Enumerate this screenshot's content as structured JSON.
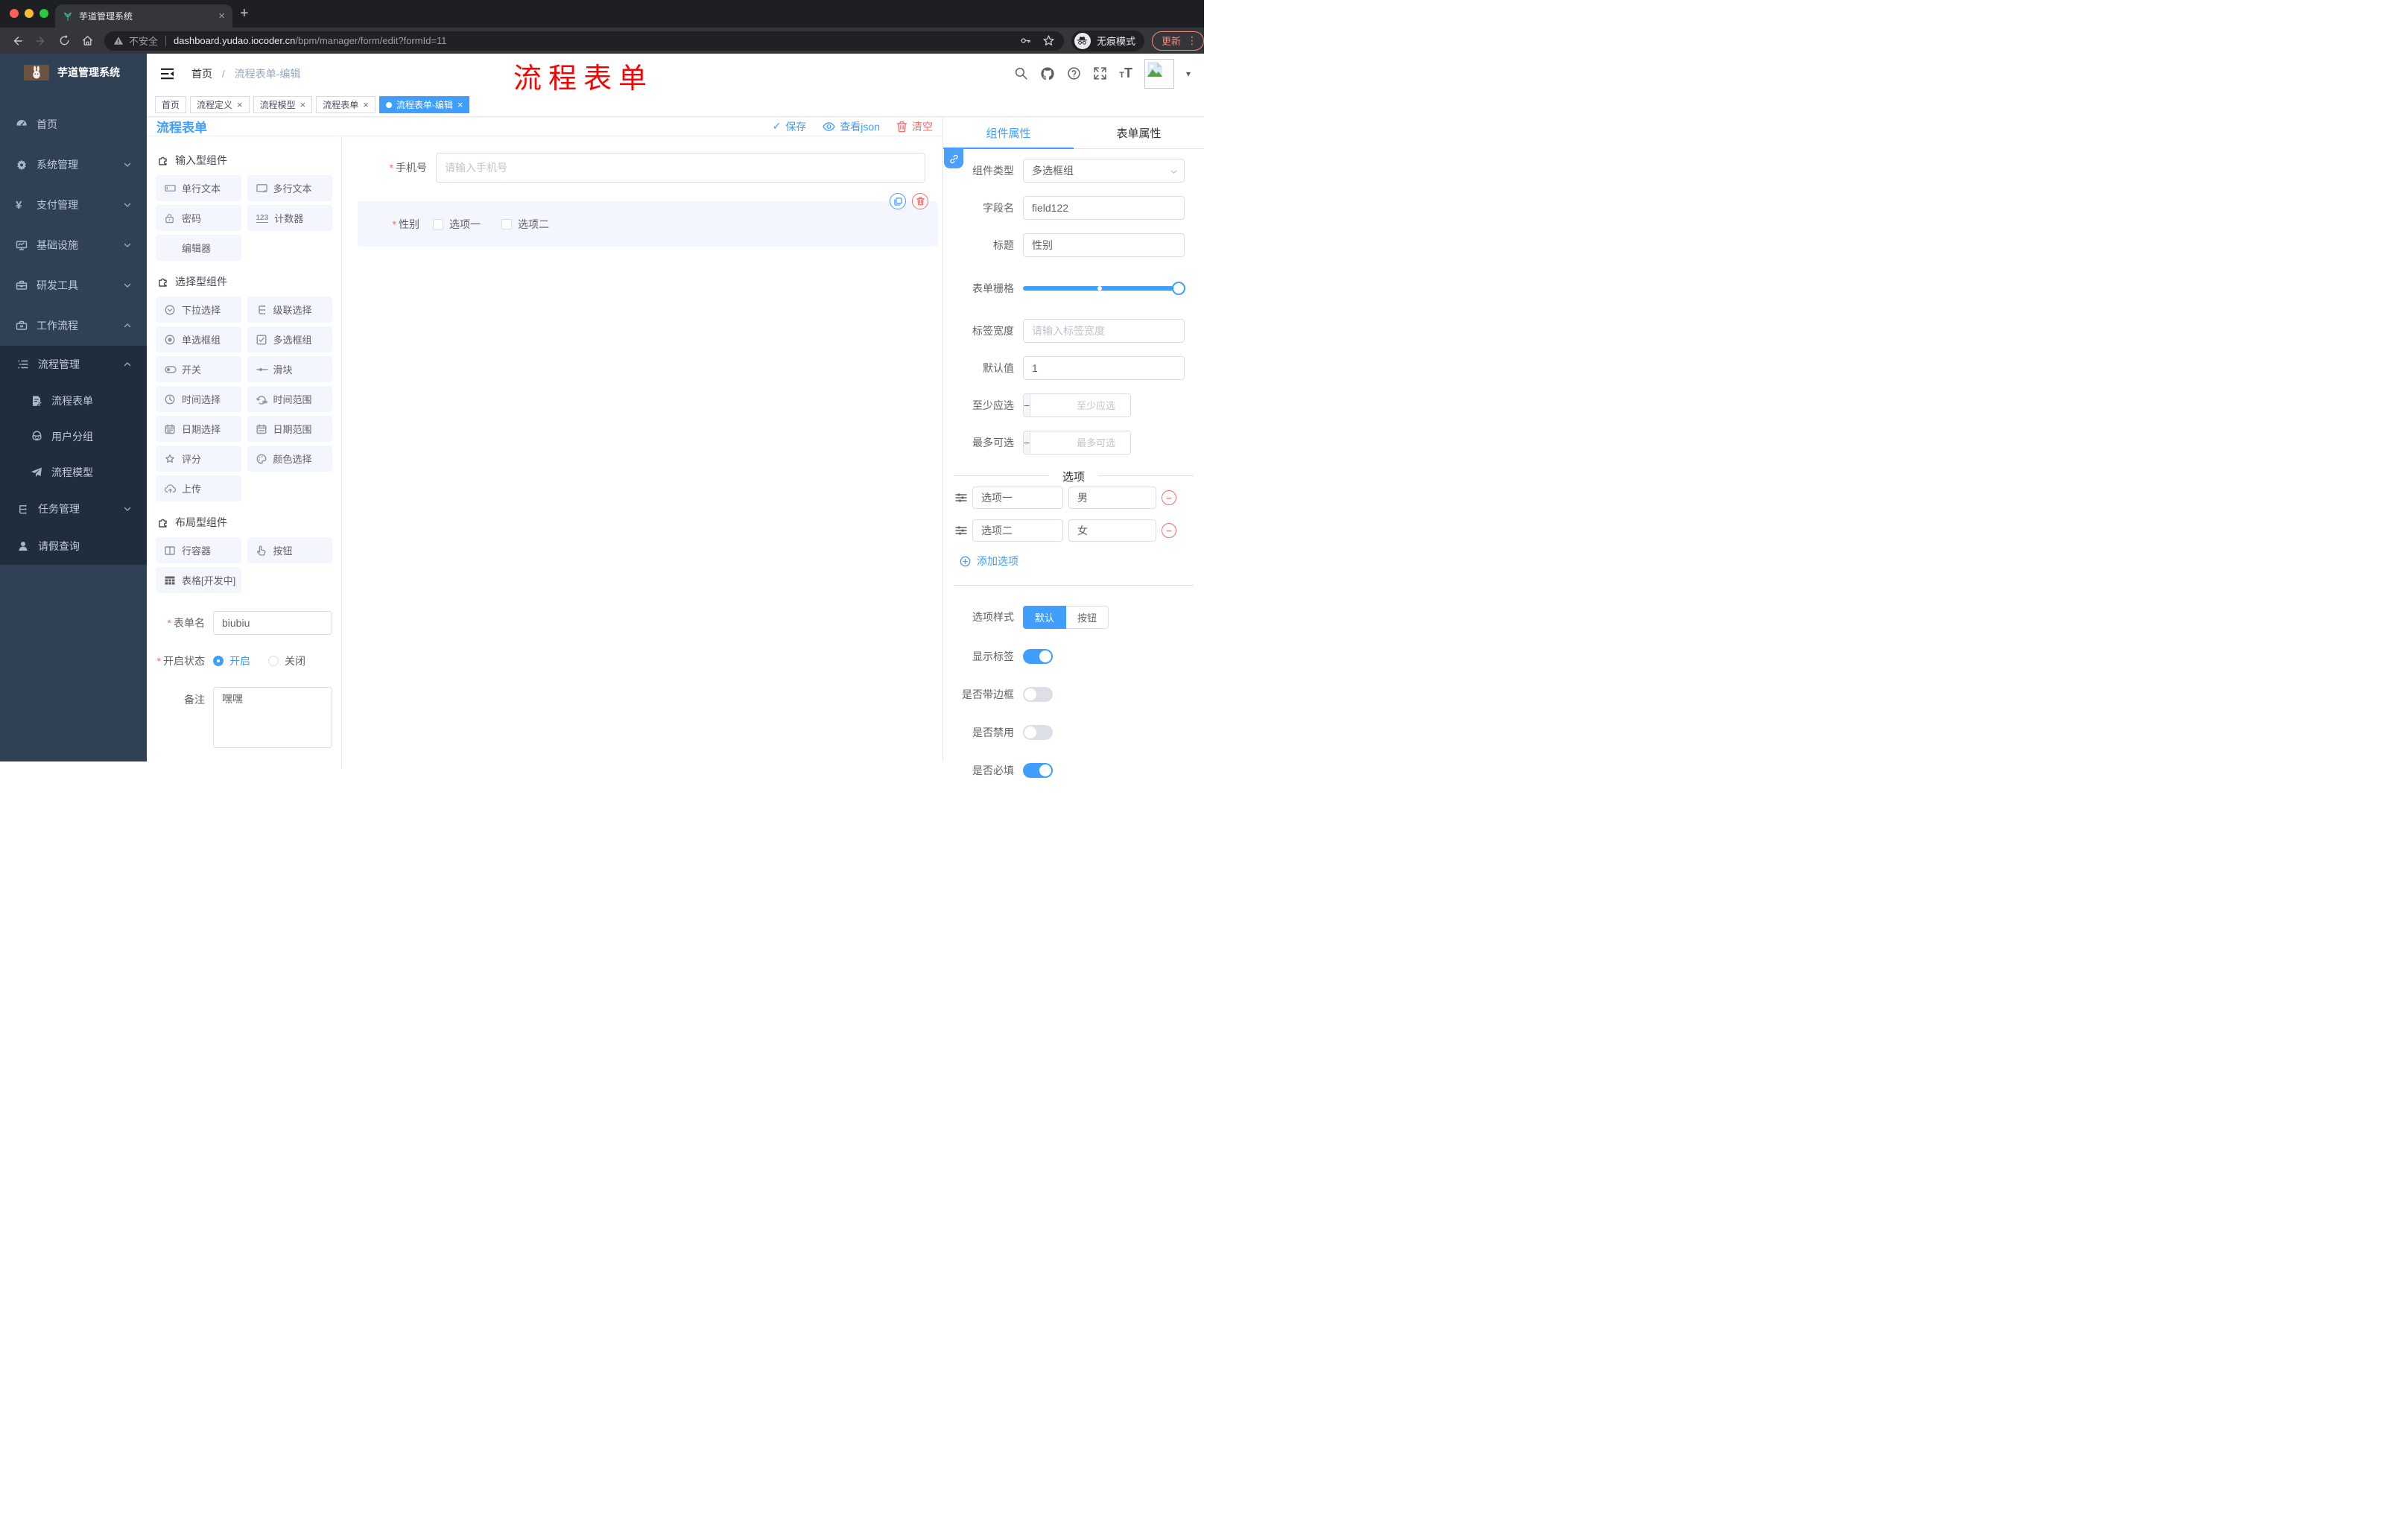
{
  "icons": {
    "close": "×",
    "plus": "+",
    "check": "✓",
    "minus": "−",
    "plus_small": "+",
    "dots": "⋮",
    "caret": "▾",
    "breadcrumb_sep": "/",
    "required": "*",
    "yen": "¥"
  },
  "browser": {
    "tab_title": "芋道管理系统",
    "security": "不安全",
    "url_host": "dashboard.yudao.iocoder.cn",
    "url_path": "/bpm/manager/form/edit?formId=11",
    "incognito": "无痕模式",
    "update": "更新"
  },
  "sidebar": {
    "app_title": "芋道管理系统",
    "menu": [
      {
        "label": "首页"
      },
      {
        "label": "系统管理"
      },
      {
        "label": "支付管理"
      },
      {
        "label": "基础设施"
      },
      {
        "label": "研发工具"
      },
      {
        "label": "工作流程"
      }
    ],
    "submenu": [
      {
        "label": "流程管理"
      },
      {
        "label": "流程表单"
      },
      {
        "label": "用户分组"
      },
      {
        "label": "流程模型"
      },
      {
        "label": "任务管理"
      },
      {
        "label": "请假查询"
      }
    ]
  },
  "header": {
    "breadcrumb_home": "首页",
    "breadcrumb_current": "流程表单-编辑",
    "annotation": "流程表单"
  },
  "tags": [
    {
      "label": "首页"
    },
    {
      "label": "流程定义"
    },
    {
      "label": "流程模型"
    },
    {
      "label": "流程表单"
    },
    {
      "label": "流程表单-编辑"
    }
  ],
  "designer": {
    "title": "流程表单",
    "toolbar": {
      "save": "保存",
      "view_json": "查看json",
      "clear": "清空"
    },
    "groups": {
      "input": {
        "title": "输入型组件",
        "items": [
          "单行文本",
          "多行文本",
          "密码",
          "计数器",
          "编辑器"
        ]
      },
      "select": {
        "title": "选择型组件",
        "items": [
          "下拉选择",
          "级联选择",
          "单选框组",
          "多选框组",
          "开关",
          "滑块",
          "时间选择",
          "时间范围",
          "日期选择",
          "日期范围",
          "评分",
          "颜色选择",
          "上传"
        ]
      },
      "layout": {
        "title": "布局型组件",
        "items": [
          "行容器",
          "按钮",
          "表格[开发中]"
        ]
      }
    },
    "meta": {
      "name_label": "表单名",
      "name_value": "biubiu",
      "status_label": "开启状态",
      "status_on": "开启",
      "status_off": "关闭",
      "remark_label": "备注",
      "remark_value": "嘿嘿"
    },
    "canvas": {
      "phone_label": "手机号",
      "phone_placeholder": "请输入手机号",
      "gender_label": "性别",
      "gender_option1": "选项一",
      "gender_option2": "选项二"
    }
  },
  "props": {
    "tab_component": "组件属性",
    "tab_form": "表单属性",
    "component_type_label": "组件类型",
    "component_type_value": "多选框组",
    "field_name_label": "字段名",
    "field_name_value": "field122",
    "title_label": "标题",
    "title_value": "性别",
    "grid_label": "表单栅格",
    "label_width_label": "标签宽度",
    "label_width_placeholder": "请输入标签宽度",
    "default_label": "默认值",
    "default_value": "1",
    "min_label": "至少应选",
    "min_placeholder": "至少应选",
    "max_label": "最多可选",
    "max_placeholder": "最多可选",
    "options_title": "选项",
    "options": [
      {
        "name": "选项一",
        "value": "男"
      },
      {
        "name": "选项二",
        "value": "女"
      }
    ],
    "add_option": "添加选项",
    "style_label": "选项样式",
    "style_default": "默认",
    "style_button": "按钮",
    "show_label": "显示标签",
    "border_label": "是否带边框",
    "disabled_label": "是否禁用",
    "required_label": "是否必填"
  }
}
